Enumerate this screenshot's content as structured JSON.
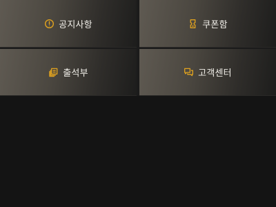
{
  "colors": {
    "background": "#141414",
    "tile_gradient_start": "#5f5a52",
    "tile_gradient_end": "#1d1d1c",
    "icon_accent": "#e0a21f",
    "label_text": "#f1efe9"
  },
  "menu": {
    "items": [
      {
        "label": "공지사항",
        "icon": "alert-circle-icon"
      },
      {
        "label": "쿠폰함",
        "icon": "coupon-icon"
      },
      {
        "label": "출석부",
        "icon": "attendance-book-icon"
      },
      {
        "label": "고객센터",
        "icon": "chat-bubbles-icon"
      }
    ]
  }
}
